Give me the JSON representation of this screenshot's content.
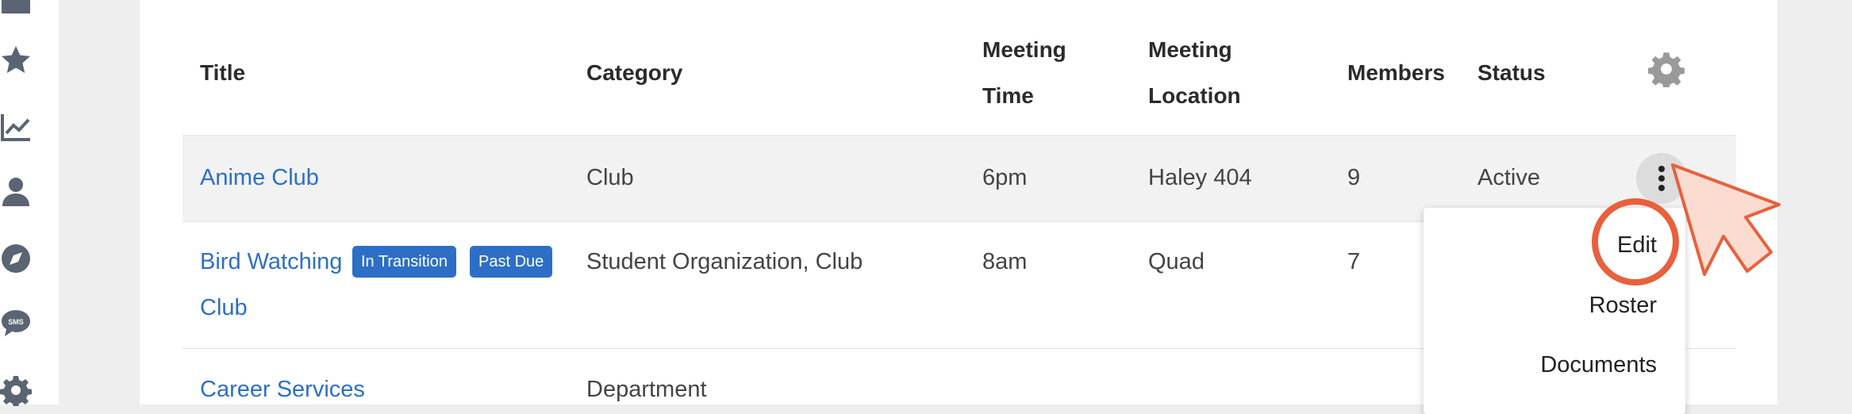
{
  "table": {
    "headers": {
      "title": "Title",
      "category": "Category",
      "meeting_time_1": "Meeting",
      "meeting_time_2": "Time",
      "meeting_location_1": "Meeting",
      "meeting_location_2": "Location",
      "members": "Members",
      "status": "Status"
    },
    "rows": [
      {
        "title": "Anime Club",
        "category": "Club",
        "meeting_time": "6pm",
        "meeting_location": "Haley 404",
        "members": "9",
        "status": "Active"
      },
      {
        "title_line1": "Bird Watching",
        "title_line2": "Club",
        "badges": [
          "In Transition",
          "Past Due"
        ],
        "category": "Student Organization, Club",
        "meeting_time": "8am",
        "meeting_location": "Quad",
        "members": "7"
      },
      {
        "title": "Career Services",
        "category": "Department"
      }
    ]
  },
  "row_menu": {
    "items": [
      "Edit",
      "Roster",
      "Documents"
    ]
  },
  "icons": {
    "rail": [
      "folder-icon",
      "star-icon",
      "chart-line-icon",
      "user-icon",
      "compass-icon",
      "sms-icon",
      "gear-icon"
    ],
    "header_settings": "gear-icon",
    "row_actions": "kebab-icon",
    "pointer": "cursor-arrow-icon"
  },
  "colors": {
    "link": "#2d6fc7",
    "badge": "#2d6fc7",
    "highlight": "#e8603c",
    "row_hover": "#f2f2f2",
    "rail_icon": "#5a6472"
  }
}
